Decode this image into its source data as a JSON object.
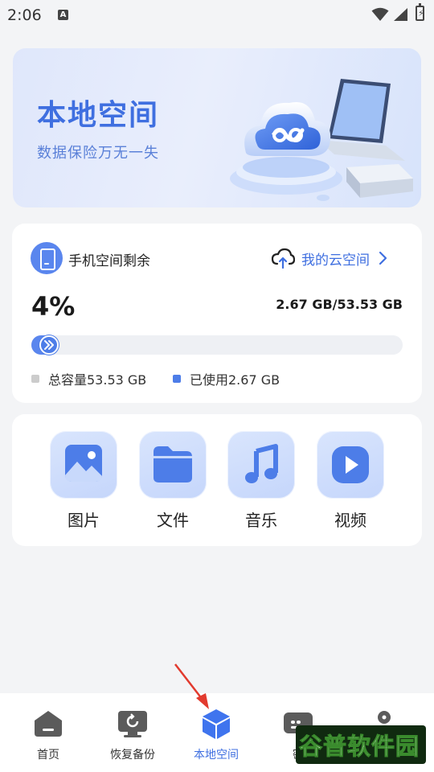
{
  "status_bar": {
    "time": "2:06",
    "notification_letter": "A"
  },
  "banner": {
    "title": "本地空间",
    "subtitle": "数据保险万无一失"
  },
  "storage": {
    "label": "手机空间剩余",
    "cloud_link_label": "我的云空间",
    "percent_text": "4%",
    "percent_value": 0.04,
    "used_total": "2.67 GB/53.53 GB",
    "legend_total": "总容量53.53 GB",
    "legend_used": "已使用2.67 GB",
    "colors": {
      "accent": "#4d7de8",
      "total_dot": "#cccccc"
    }
  },
  "categories": [
    {
      "label": "图片",
      "icon": "image-icon"
    },
    {
      "label": "文件",
      "icon": "folder-icon"
    },
    {
      "label": "音乐",
      "icon": "music-note-icon"
    },
    {
      "label": "视频",
      "icon": "play-video-icon"
    }
  ],
  "bottom_nav": [
    {
      "label": "首页",
      "icon": "home-icon",
      "active": false
    },
    {
      "label": "恢复备份",
      "icon": "restore-backup-icon",
      "active": false
    },
    {
      "label": "本地空间",
      "icon": "cube-icon",
      "active": true
    },
    {
      "label": "密",
      "icon": "password-icon",
      "active": false
    },
    {
      "label": "",
      "icon": "profile-icon",
      "active": false
    }
  ],
  "watermark": {
    "text": "谷普软件园"
  }
}
